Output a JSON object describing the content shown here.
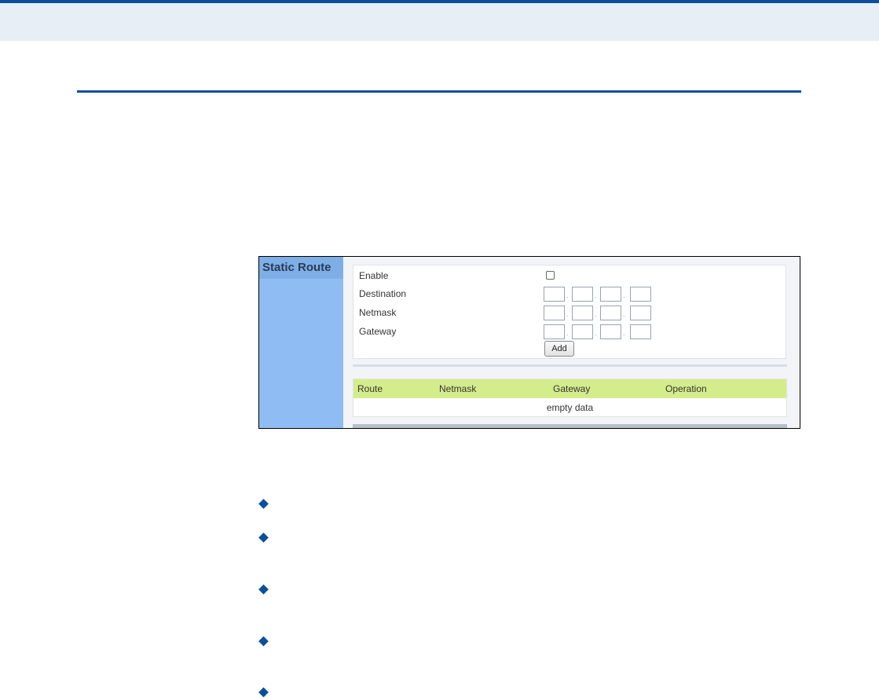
{
  "panel": {
    "title": "Static Route",
    "labels": {
      "enable": "Enable",
      "destination": "Destination",
      "netmask": "Netmask",
      "gateway": "Gateway"
    },
    "ip_separator": ".",
    "add_label": "Add"
  },
  "table": {
    "columns": [
      "Route",
      "Netmask",
      "Gateway",
      "Operation"
    ],
    "empty_text": "empty data"
  },
  "colors": {
    "accent": "#0b4f9c",
    "sidebar": "#8fbdf3",
    "table_header": "#d5ec8c"
  },
  "icons": {
    "bullet": "diamond-icon"
  }
}
